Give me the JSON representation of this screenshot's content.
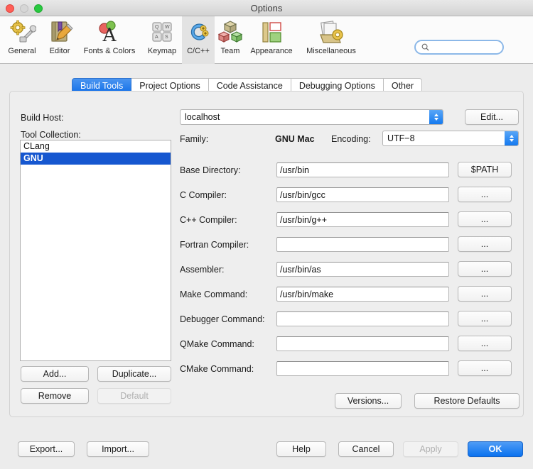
{
  "window": {
    "title": "Options",
    "traffic": {
      "close": "close-button",
      "minimize": "minimize-button",
      "maximize": "maximize-button"
    }
  },
  "toolbar": {
    "items": [
      {
        "label": "General",
        "icon": "gear-wrench-icon",
        "selected": false
      },
      {
        "label": "Editor",
        "icon": "book-pencil-icon",
        "selected": false
      },
      {
        "label": "Fonts & Colors",
        "icon": "font-palette-icon",
        "selected": false
      },
      {
        "label": "Keymap",
        "icon": "keyboard-keys-icon",
        "selected": false
      },
      {
        "label": "C/C++",
        "icon": "c-plus-plus-icon",
        "selected": true
      },
      {
        "label": "Team",
        "icon": "team-cubes-icon",
        "selected": false
      },
      {
        "label": "Appearance",
        "icon": "appearance-layout-icon",
        "selected": false
      },
      {
        "label": "Miscellaneous",
        "icon": "misc-papers-gear-icon",
        "selected": false
      }
    ],
    "search": {
      "value": "",
      "placeholder": "",
      "icon": "search-icon"
    }
  },
  "tabs": [
    {
      "label": "Build Tools",
      "active": true
    },
    {
      "label": "Project Options",
      "active": false
    },
    {
      "label": "Code Assistance",
      "active": false
    },
    {
      "label": "Debugging Options",
      "active": false
    },
    {
      "label": "Other",
      "active": false
    }
  ],
  "form": {
    "build_host_label": "Build Host:",
    "build_host_value": "localhost",
    "edit_button": "Edit...",
    "tool_collection_label": "Tool Collection:",
    "tool_collection_items": [
      {
        "label": "CLang",
        "selected": false
      },
      {
        "label": "GNU",
        "selected": true
      }
    ],
    "family_label": "Family:",
    "family_value": "GNU Mac",
    "encoding_label": "Encoding:",
    "encoding_value": "UTF−8",
    "rows": [
      {
        "label": "Base Directory:",
        "value": "/usr/bin",
        "button": "$PATH"
      },
      {
        "label": "C Compiler:",
        "value": "/usr/bin/gcc",
        "button": "..."
      },
      {
        "label": "C++ Compiler:",
        "value": "/usr/bin/g++",
        "button": "..."
      },
      {
        "label": "Fortran Compiler:",
        "value": "",
        "button": "..."
      },
      {
        "label": "Assembler:",
        "value": "/usr/bin/as",
        "button": "..."
      },
      {
        "label": "Make Command:",
        "value": "/usr/bin/make",
        "button": "..."
      },
      {
        "label": "Debugger Command:",
        "value": "",
        "button": "..."
      },
      {
        "label": "QMake Command:",
        "value": "",
        "button": "..."
      },
      {
        "label": "CMake Command:",
        "value": "",
        "button": "..."
      }
    ],
    "list_buttons": [
      {
        "label": "Add...",
        "disabled": false
      },
      {
        "label": "Duplicate...",
        "disabled": false
      },
      {
        "label": "Remove",
        "disabled": false
      },
      {
        "label": "Default",
        "disabled": true
      }
    ],
    "versions_button": "Versions...",
    "restore_defaults_button": "Restore Defaults"
  },
  "footer": {
    "export_button": "Export...",
    "import_button": "Import...",
    "help_button": "Help",
    "cancel_button": "Cancel",
    "apply_button": "Apply",
    "ok_button": "OK"
  },
  "colors": {
    "accent_blue": "#1470e8",
    "selection_blue": "#1657d0",
    "window_bg": "#ececec",
    "panel_bg": "#eeeeee"
  }
}
